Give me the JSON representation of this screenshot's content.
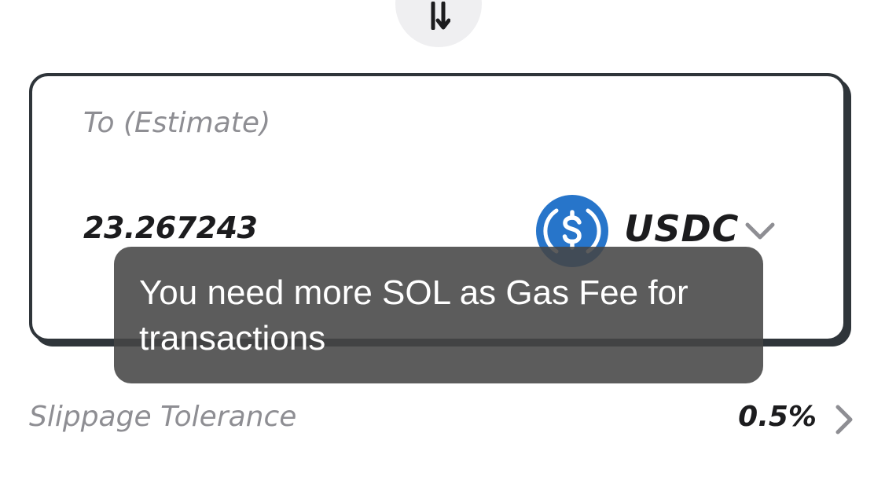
{
  "swap": {
    "icon": "swap-arrows-icon"
  },
  "to_card": {
    "label": "To (Estimate)",
    "amount": "23.267243",
    "token": {
      "symbol": "USDC",
      "icon": "usdc-coin-icon",
      "icon_color": "#2775ca",
      "dropdown_icon": "chevron-down-icon"
    }
  },
  "toast": {
    "message": "You need more SOL as Gas Fee for transactions"
  },
  "slippage": {
    "label": "Slippage Tolerance",
    "value": "0.5%",
    "icon": "chevron-right-icon"
  }
}
